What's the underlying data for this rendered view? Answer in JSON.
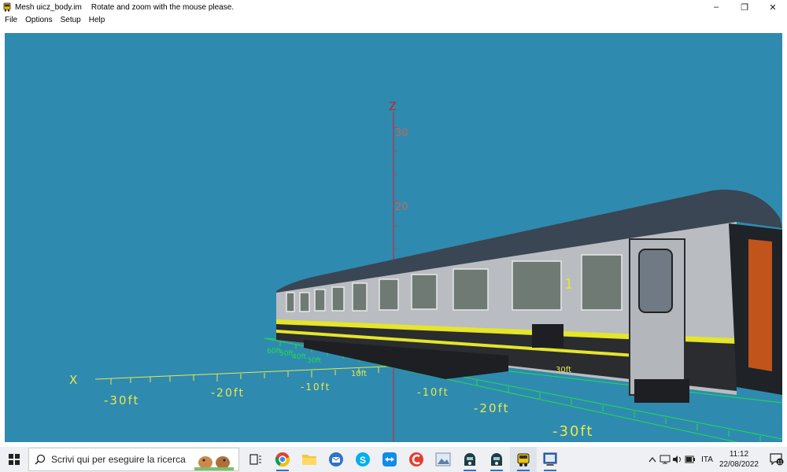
{
  "window": {
    "title": "Mesh uicz_body.im",
    "hint": "Rotate and zoom with the mouse please.",
    "controls": {
      "minimize": "–",
      "restore": "❐",
      "close": "✕"
    }
  },
  "menu": {
    "items": [
      "File",
      "Options",
      "Setup",
      "Help"
    ]
  },
  "viewport": {
    "background": "#2f8ab0",
    "axes": {
      "z_label": "Z",
      "x_label": "X",
      "z_ticks": [
        "30",
        "20"
      ],
      "yellow_ticks": [
        "-30ft",
        "-20ft",
        "-10ft",
        "10ft",
        "-10ft",
        "-20ft",
        "-30ft"
      ],
      "green_ticks": [
        "60ft",
        "50ft",
        "40ft",
        "30ft",
        "30ft"
      ]
    },
    "model": {
      "name": "uicz_body",
      "class_marker": "1",
      "colors": {
        "roof": "#3a4653",
        "body": "#b9bcc0",
        "stripe": "#e5e52a",
        "underframe": "#2a2c2f"
      }
    }
  },
  "taskbar": {
    "search_placeholder": "Scrivi qui per eseguire la ricerca",
    "apps": [
      "task-view-icon",
      "chrome-icon",
      "file-explorer-icon",
      "thunderbird-icon",
      "skype-icon",
      "teamviewer-icon",
      "ccleaner-icon",
      "photos-icon",
      "trainz-icon",
      "trainz-icon-2",
      "mesh-viewer-icon",
      "settings-tool-icon"
    ],
    "language": "ITA",
    "time": "11:12",
    "date": "22/08/2022",
    "notification_count": "11"
  }
}
